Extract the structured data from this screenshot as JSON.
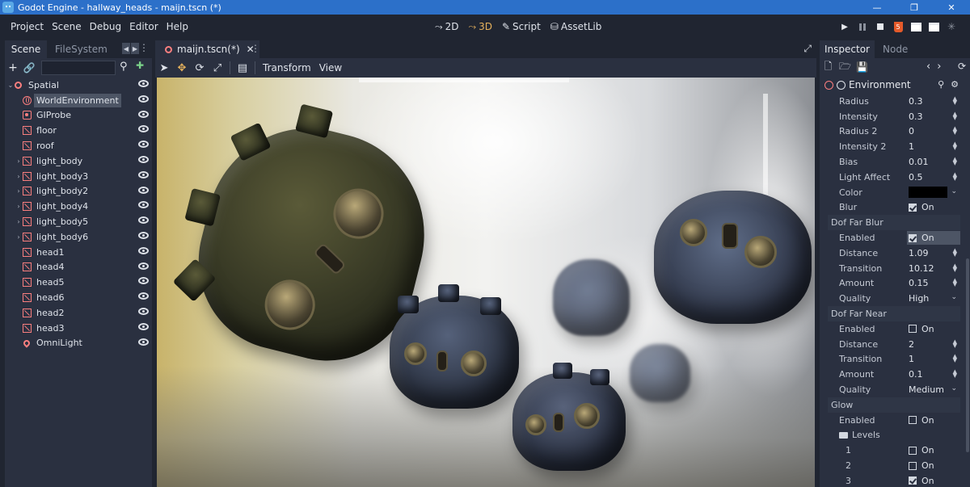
{
  "window": {
    "title": "Godot Engine - hallway_heads - maijn.tscn (*)",
    "minimize": "—",
    "maximize": "❐",
    "close": "✕"
  },
  "menu": [
    "Project",
    "Scene",
    "Debug",
    "Editor",
    "Help"
  ],
  "workspaces": [
    {
      "label": "2D",
      "glyph": "⤳"
    },
    {
      "label": "3D",
      "glyph": "⤳"
    },
    {
      "label": "Script",
      "glyph": "✎"
    },
    {
      "label": "AssetLib",
      "glyph": "⛁"
    }
  ],
  "left_dock": {
    "tabs": [
      "Scene",
      "FileSystem"
    ],
    "filter_placeholder": "",
    "tree": [
      {
        "label": "Spatial",
        "icon": "circle",
        "arrow": "⌄",
        "indent": 0
      },
      {
        "label": "WorldEnvironment",
        "icon": "globe",
        "arrow": "",
        "indent": 1
      },
      {
        "label": "GIProbe",
        "icon": "probe",
        "arrow": "",
        "indent": 1
      },
      {
        "label": "floor",
        "icon": "mesh",
        "arrow": "",
        "indent": 1
      },
      {
        "label": "roof",
        "icon": "mesh",
        "arrow": "",
        "indent": 1
      },
      {
        "label": "light_body",
        "icon": "mesh",
        "arrow": "›",
        "indent": 1
      },
      {
        "label": "light_body3",
        "icon": "mesh",
        "arrow": "›",
        "indent": 1
      },
      {
        "label": "light_body2",
        "icon": "mesh",
        "arrow": "›",
        "indent": 1
      },
      {
        "label": "light_body4",
        "icon": "mesh",
        "arrow": "›",
        "indent": 1
      },
      {
        "label": "light_body5",
        "icon": "mesh",
        "arrow": "›",
        "indent": 1
      },
      {
        "label": "light_body6",
        "icon": "mesh",
        "arrow": "›",
        "indent": 1
      },
      {
        "label": "head1",
        "icon": "mesh",
        "arrow": "",
        "indent": 1
      },
      {
        "label": "head4",
        "icon": "mesh",
        "arrow": "",
        "indent": 1
      },
      {
        "label": "head5",
        "icon": "mesh",
        "arrow": "",
        "indent": 1
      },
      {
        "label": "head6",
        "icon": "mesh",
        "arrow": "",
        "indent": 1
      },
      {
        "label": "head2",
        "icon": "mesh",
        "arrow": "",
        "indent": 1
      },
      {
        "label": "head3",
        "icon": "mesh",
        "arrow": "",
        "indent": 1
      },
      {
        "label": "OmniLight",
        "icon": "pin",
        "arrow": "",
        "indent": 1
      }
    ],
    "selected": "WorldEnvironment"
  },
  "editor": {
    "scene_tab": "maijn.tscn(*)",
    "toolbar_menus": [
      "Transform",
      "View"
    ]
  },
  "inspector": {
    "tabs": [
      "Inspector",
      "Node"
    ],
    "object": "Environment",
    "properties": [
      {
        "type": "num",
        "name": "Radius",
        "value": "0.3"
      },
      {
        "type": "num",
        "name": "Intensity",
        "value": "0.3"
      },
      {
        "type": "num",
        "name": "Radius 2",
        "value": "0"
      },
      {
        "type": "num",
        "name": "Intensity 2",
        "value": "1"
      },
      {
        "type": "num",
        "name": "Bias",
        "value": "0.01"
      },
      {
        "type": "num",
        "name": "Light Affect",
        "value": "0.5"
      },
      {
        "type": "color",
        "name": "Color",
        "value": "#000000"
      },
      {
        "type": "check",
        "name": "Blur",
        "value": "On",
        "checked": true
      },
      {
        "type": "section",
        "name": "Dof Far Blur"
      },
      {
        "type": "check",
        "name": "Enabled",
        "value": "On",
        "checked": true,
        "highlight": true
      },
      {
        "type": "num",
        "name": "Distance",
        "value": "1.09"
      },
      {
        "type": "num",
        "name": "Transition",
        "value": "10.12"
      },
      {
        "type": "num",
        "name": "Amount",
        "value": "0.15"
      },
      {
        "type": "enum",
        "name": "Quality",
        "value": "High"
      },
      {
        "type": "section",
        "name": "Dof Far Near"
      },
      {
        "type": "check",
        "name": "Enabled",
        "value": "On",
        "checked": false
      },
      {
        "type": "num",
        "name": "Distance",
        "value": "2"
      },
      {
        "type": "num",
        "name": "Transition",
        "value": "1"
      },
      {
        "type": "num",
        "name": "Amount",
        "value": "0.1"
      },
      {
        "type": "enum",
        "name": "Quality",
        "value": "Medium"
      },
      {
        "type": "section",
        "name": "Glow"
      },
      {
        "type": "check",
        "name": "Enabled",
        "value": "On",
        "checked": false
      },
      {
        "type": "folder",
        "name": "Levels"
      },
      {
        "type": "check",
        "name": "1",
        "value": "On",
        "checked": false,
        "sub": true
      },
      {
        "type": "check",
        "name": "2",
        "value": "On",
        "checked": false,
        "sub": true
      },
      {
        "type": "check",
        "name": "3",
        "value": "On",
        "checked": true,
        "sub": true
      }
    ]
  },
  "colors": {
    "accent": "#2c70c9",
    "node_icon": "#fc7f7f",
    "active_workspace": "#e5b15c"
  }
}
